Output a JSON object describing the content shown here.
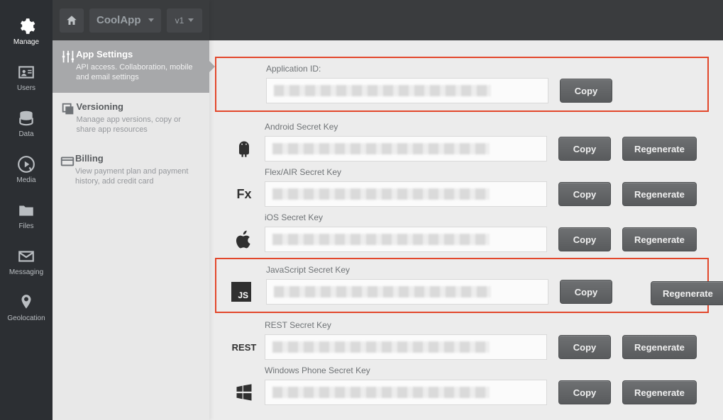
{
  "header": {
    "app_name": "CoolApp",
    "version": "v1"
  },
  "rail": {
    "items": [
      {
        "label": "Manage"
      },
      {
        "label": "Users"
      },
      {
        "label": "Data"
      },
      {
        "label": "Media"
      },
      {
        "label": "Files"
      },
      {
        "label": "Messaging"
      },
      {
        "label": "Geolocation"
      }
    ]
  },
  "sidebar": {
    "items": [
      {
        "title": "App Settings",
        "desc": "API access. Collaboration, mobile and email settings"
      },
      {
        "title": "Versioning",
        "desc": "Manage app versions, copy or share app resources"
      },
      {
        "title": "Billing",
        "desc": "View payment plan and payment history, add credit card"
      }
    ]
  },
  "keys": {
    "app_id": {
      "label": "Application ID:",
      "copy": "Copy"
    },
    "android": {
      "label": "Android Secret Key",
      "copy": "Copy",
      "regen": "Regenerate"
    },
    "flex": {
      "label": "Flex/AIR Secret Key",
      "icon_text": "Fx",
      "copy": "Copy",
      "regen": "Regenerate"
    },
    "ios": {
      "label": "iOS Secret Key",
      "copy": "Copy",
      "regen": "Regenerate"
    },
    "js": {
      "label": "JavaScript Secret Key",
      "icon_text": "JS",
      "copy": "Copy",
      "regen": "Regenerate"
    },
    "rest": {
      "label": "REST Secret Key",
      "icon_text": "REST",
      "copy": "Copy",
      "regen": "Regenerate"
    },
    "wp": {
      "label": "Windows Phone Secret Key",
      "copy": "Copy",
      "regen": "Regenerate"
    }
  }
}
